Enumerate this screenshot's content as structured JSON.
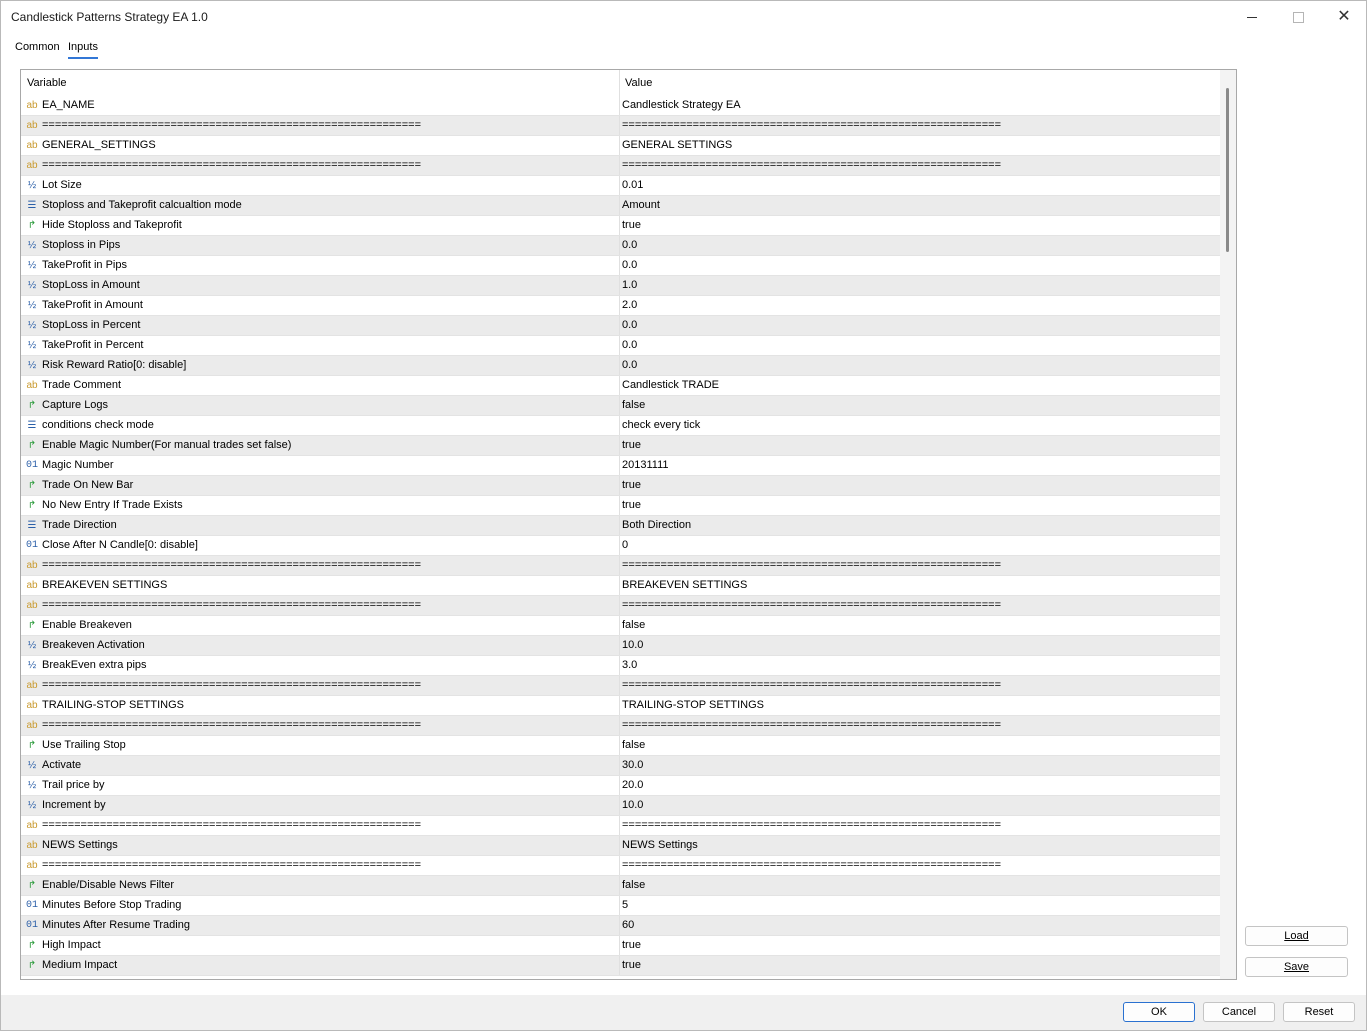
{
  "window": {
    "title": "Candlestick Patterns Strategy EA 1.0"
  },
  "tabs": [
    {
      "label": "Common"
    },
    {
      "label": "Inputs"
    }
  ],
  "grid": {
    "headers": {
      "variable": "Variable",
      "value": "Value"
    },
    "rows": [
      {
        "icon": "ab",
        "variable": "EA_NAME",
        "value": "Candlestick Strategy EA"
      },
      {
        "icon": "ab",
        "variable": "===========================================================",
        "value": "==========================================================="
      },
      {
        "icon": "ab",
        "variable": "GENERAL_SETTINGS",
        "value": "GENERAL SETTINGS"
      },
      {
        "icon": "ab",
        "variable": "===========================================================",
        "value": "==========================================================="
      },
      {
        "icon": "half",
        "variable": "Lot Size",
        "value": "0.01"
      },
      {
        "icon": "enum",
        "variable": "Stoploss and Takeprofit calcualtion mode",
        "value": "Amount"
      },
      {
        "icon": "bool",
        "variable": "Hide Stoploss and Takeprofit",
        "value": "true"
      },
      {
        "icon": "half",
        "variable": "Stoploss in Pips",
        "value": "0.0"
      },
      {
        "icon": "half",
        "variable": "TakeProfit in Pips",
        "value": "0.0"
      },
      {
        "icon": "half",
        "variable": "StopLoss in Amount",
        "value": "1.0"
      },
      {
        "icon": "half",
        "variable": "TakeProfit in Amount",
        "value": "2.0"
      },
      {
        "icon": "half",
        "variable": "StopLoss in Percent",
        "value": "0.0"
      },
      {
        "icon": "half",
        "variable": "TakeProfit in Percent",
        "value": "0.0"
      },
      {
        "icon": "half",
        "variable": "Risk Reward Ratio[0: disable]",
        "value": "0.0"
      },
      {
        "icon": "ab",
        "variable": "Trade Comment",
        "value": "Candlestick TRADE"
      },
      {
        "icon": "bool",
        "variable": "Capture Logs",
        "value": "false"
      },
      {
        "icon": "enum",
        "variable": "conditions check mode",
        "value": "check every tick"
      },
      {
        "icon": "bool",
        "variable": "Enable Magic Number(For manual trades set false)",
        "value": "true"
      },
      {
        "icon": "01",
        "variable": "Magic Number",
        "value": "20131111"
      },
      {
        "icon": "bool",
        "variable": "Trade On New Bar",
        "value": "true"
      },
      {
        "icon": "bool",
        "variable": "No New Entry If Trade Exists",
        "value": "true"
      },
      {
        "icon": "enum",
        "variable": "Trade Direction",
        "value": "Both Direction"
      },
      {
        "icon": "01",
        "variable": "Close After N Candle[0: disable]",
        "value": "0"
      },
      {
        "icon": "ab",
        "variable": "===========================================================",
        "value": "==========================================================="
      },
      {
        "icon": "ab",
        "variable": "BREAKEVEN SETTINGS",
        "value": "BREAKEVEN SETTINGS"
      },
      {
        "icon": "ab",
        "variable": "===========================================================",
        "value": "==========================================================="
      },
      {
        "icon": "bool",
        "variable": "Enable Breakeven",
        "value": "false"
      },
      {
        "icon": "half",
        "variable": "Breakeven Activation",
        "value": "10.0"
      },
      {
        "icon": "half",
        "variable": "BreakEven extra pips",
        "value": "3.0"
      },
      {
        "icon": "ab",
        "variable": "===========================================================",
        "value": "==========================================================="
      },
      {
        "icon": "ab",
        "variable": "TRAILING-STOP SETTINGS",
        "value": "TRAILING-STOP SETTINGS"
      },
      {
        "icon": "ab",
        "variable": "===========================================================",
        "value": "==========================================================="
      },
      {
        "icon": "bool",
        "variable": "Use Trailing Stop",
        "value": "false"
      },
      {
        "icon": "half",
        "variable": "Activate",
        "value": "30.0"
      },
      {
        "icon": "half",
        "variable": "Trail price by",
        "value": "20.0"
      },
      {
        "icon": "half",
        "variable": "Increment by",
        "value": "10.0"
      },
      {
        "icon": "ab",
        "variable": "===========================================================",
        "value": "==========================================================="
      },
      {
        "icon": "ab",
        "variable": "NEWS Settings",
        "value": "NEWS Settings"
      },
      {
        "icon": "ab",
        "variable": "===========================================================",
        "value": "==========================================================="
      },
      {
        "icon": "bool",
        "variable": "Enable/Disable News Filter",
        "value": "false"
      },
      {
        "icon": "01",
        "variable": "Minutes Before Stop Trading",
        "value": "5"
      },
      {
        "icon": "01",
        "variable": "Minutes After Resume Trading",
        "value": "60"
      },
      {
        "icon": "bool",
        "variable": "High Impact",
        "value": "true"
      },
      {
        "icon": "bool",
        "variable": "Medium Impact",
        "value": "true"
      }
    ]
  },
  "side_buttons": {
    "load": "Load",
    "save": "Save"
  },
  "footer_buttons": {
    "ok": "OK",
    "cancel": "Cancel",
    "reset": "Reset"
  }
}
